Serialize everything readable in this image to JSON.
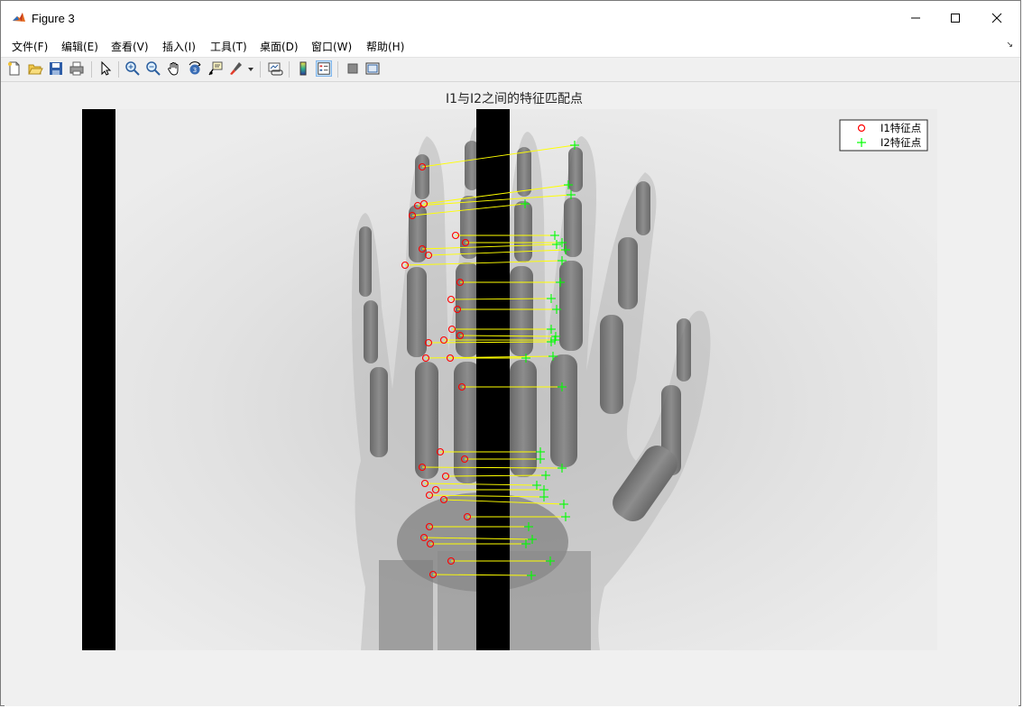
{
  "window": {
    "title": "Figure 3",
    "minimize_glyph": "—",
    "maximize_glyph": "☐",
    "close_glyph": "✕"
  },
  "menu": {
    "items": [
      "文件(F)",
      "编辑(E)",
      "查看(V)",
      "插入(I)",
      "工具(T)",
      "桌面(D)",
      "窗口(W)",
      "帮助(H)"
    ],
    "corner_glyph": "↘"
  },
  "toolbar": {
    "buttons": [
      {
        "name": "new-figure-icon"
      },
      {
        "name": "open-file-icon"
      },
      {
        "name": "save-icon"
      },
      {
        "name": "print-icon"
      },
      {
        "name": "select-arrow-icon"
      },
      {
        "name": "zoom-in-icon"
      },
      {
        "name": "zoom-out-icon"
      },
      {
        "name": "pan-hand-icon"
      },
      {
        "name": "rotate-3d-icon"
      },
      {
        "name": "data-cursor-icon"
      },
      {
        "name": "brush-icon"
      },
      {
        "name": "link-plot-icon"
      },
      {
        "name": "colorbar-icon"
      },
      {
        "name": "legend-icon"
      },
      {
        "name": "hide-plot-tools-icon"
      },
      {
        "name": "show-plot-tools-icon"
      }
    ]
  },
  "axes": {
    "title": "I1与I2之间的特征匹配点"
  },
  "legend": {
    "entries": [
      {
        "label": "I1特征点",
        "marker": "circle",
        "color": "#ff0000"
      },
      {
        "label": "I2特征点",
        "marker": "plus",
        "color": "#00ff00"
      }
    ]
  },
  "colors": {
    "match_line": "#ffff00",
    "i1_marker": "#ff0000",
    "i2_marker": "#00ff00"
  }
}
